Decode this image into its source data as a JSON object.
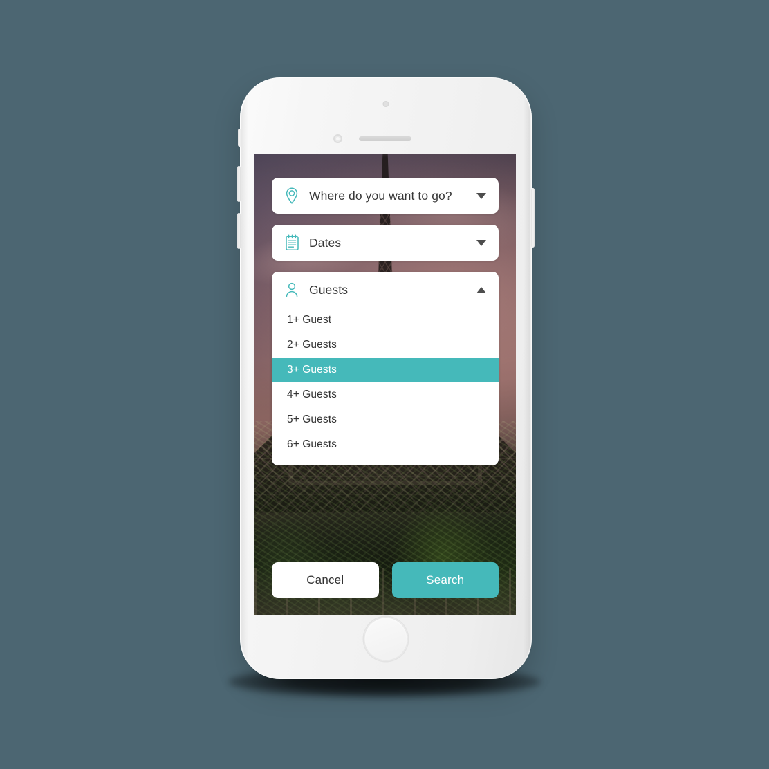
{
  "theme": {
    "page_background": "#4c6672",
    "accent": "#45b9ba",
    "field_background": "#ffffff",
    "text_color": "#373737",
    "selected_text_color": "#ffffff"
  },
  "device": {
    "name": "white-smartphone",
    "hardware": {
      "camera": "front-camera",
      "sensor": "proximity-sensor",
      "speaker": "earpiece-speaker",
      "home_button": "home-button",
      "silent_switch": "silent-switch",
      "volume_up": "volume-up-button",
      "volume_down": "volume-down-button",
      "power": "power-button"
    }
  },
  "screen": {
    "background_image": "eiffel-tower-photo"
  },
  "form": {
    "fields": [
      {
        "id": "destination",
        "icon": "map-pin-icon",
        "label": "Where do you want to go?",
        "caret": "down",
        "open": false
      },
      {
        "id": "dates",
        "icon": "calendar-icon",
        "label": "Dates",
        "caret": "down",
        "open": false
      }
    ],
    "guests": {
      "id": "guests",
      "icon": "person-icon",
      "label": "Guests",
      "caret": "up",
      "open": true,
      "selected_value": "3+ Guests",
      "options": [
        "1+ Guest",
        "2+ Guests",
        "3+ Guests",
        "4+ Guests",
        "5+ Guests",
        "6+ Guests"
      ]
    }
  },
  "actions": {
    "cancel_label": "Cancel",
    "search_label": "Search"
  }
}
